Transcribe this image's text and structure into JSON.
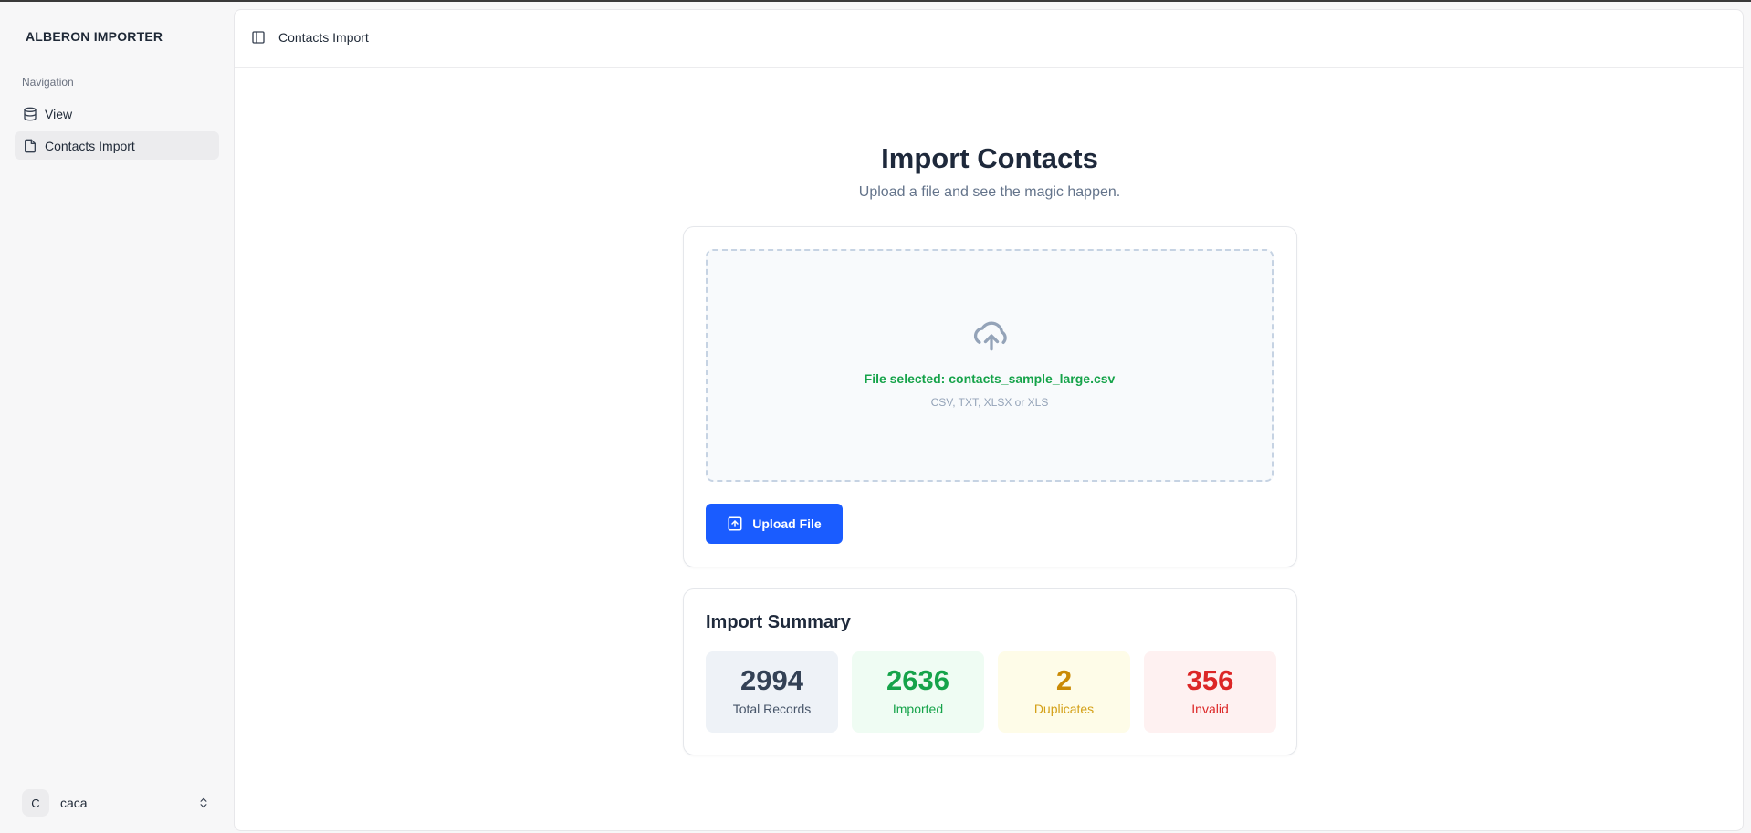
{
  "app": {
    "brand": "ALBERON IMPORTER"
  },
  "sidebar": {
    "caption": "Navigation",
    "items": [
      {
        "label": "View",
        "icon": "database-icon",
        "active": false
      },
      {
        "label": "Contacts Import",
        "icon": "file-icon",
        "active": true
      }
    ],
    "user": {
      "initial": "C",
      "name": "caca"
    }
  },
  "header": {
    "title": "Contacts Import"
  },
  "main": {
    "title": "Import Contacts",
    "subtitle": "Upload a file and see the magic happen.",
    "dropzone": {
      "icon": "cloud-upload-icon",
      "selected_text": "File selected: contacts_sample_large.csv",
      "formats": "CSV, TXT, XLSX or XLS"
    },
    "upload_button": {
      "label": "Upload File",
      "icon": "upload-icon"
    },
    "summary": {
      "title": "Import Summary",
      "stats": [
        {
          "value": "2994",
          "label": "Total Records"
        },
        {
          "value": "2636",
          "label": "Imported"
        },
        {
          "value": "2",
          "label": "Duplicates"
        },
        {
          "value": "356",
          "label": "Invalid"
        }
      ]
    }
  },
  "colors": {
    "accent": "#1a5cff",
    "success": "#16a34a",
    "warning": "#ca8a04",
    "danger": "#dc2626"
  }
}
